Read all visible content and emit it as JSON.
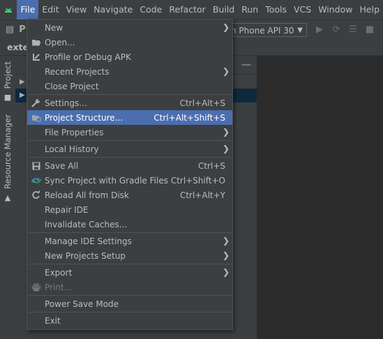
{
  "menubar": {
    "items": [
      "File",
      "Edit",
      "View",
      "Navigate",
      "Code",
      "Refactor",
      "Build",
      "Run",
      "Tools",
      "VCS",
      "Window",
      "Help"
    ],
    "active_index": 0
  },
  "toolbar": {
    "device": "n Phone API 30"
  },
  "tabstrip": {
    "crumb": "exte"
  },
  "leftstrip": {
    "project_label": "Project",
    "resource_manager_label": "Resource Manager"
  },
  "file_menu": {
    "items": [
      {
        "label": "New",
        "shortcut": "",
        "submenu": true,
        "icon": ""
      },
      {
        "label": "Open...",
        "shortcut": "",
        "submenu": false,
        "icon": "folder-open-icon"
      },
      {
        "label": "Profile or Debug APK",
        "shortcut": "",
        "submenu": false,
        "icon": "debug-apk-icon"
      },
      {
        "label": "Recent Projects",
        "shortcut": "",
        "submenu": true,
        "icon": ""
      },
      {
        "label": "Close Project",
        "shortcut": "",
        "submenu": false,
        "icon": ""
      },
      {
        "label": "Settings...",
        "shortcut": "Ctrl+Alt+S",
        "submenu": false,
        "icon": "wrench-icon"
      },
      {
        "label": "Project Structure...",
        "shortcut": "Ctrl+Alt+Shift+S",
        "submenu": false,
        "icon": "project-structure-icon",
        "selected": true
      },
      {
        "label": "File Properties",
        "shortcut": "",
        "submenu": true,
        "icon": ""
      },
      {
        "label": "Local History",
        "shortcut": "",
        "submenu": true,
        "icon": ""
      },
      {
        "label": "Save All",
        "shortcut": "Ctrl+S",
        "submenu": false,
        "icon": "save-icon"
      },
      {
        "label": "Sync Project with Gradle Files",
        "shortcut": "Ctrl+Shift+O",
        "submenu": false,
        "icon": "gradle-sync-icon"
      },
      {
        "label": "Reload All from Disk",
        "shortcut": "Ctrl+Alt+Y",
        "submenu": false,
        "icon": "reload-icon"
      },
      {
        "label": "Repair IDE",
        "shortcut": "",
        "submenu": false,
        "icon": ""
      },
      {
        "label": "Invalidate Caches...",
        "shortcut": "",
        "submenu": false,
        "icon": ""
      },
      {
        "label": "Manage IDE Settings",
        "shortcut": "",
        "submenu": true,
        "icon": ""
      },
      {
        "label": "New Projects Setup",
        "shortcut": "",
        "submenu": true,
        "icon": ""
      },
      {
        "label": "Export",
        "shortcut": "",
        "submenu": true,
        "icon": ""
      },
      {
        "label": "Print...",
        "shortcut": "",
        "submenu": false,
        "icon": "print-icon",
        "disabled": true
      },
      {
        "label": "Power Save Mode",
        "shortcut": "",
        "submenu": false,
        "icon": ""
      },
      {
        "label": "Exit",
        "shortcut": "",
        "submenu": false,
        "icon": ""
      }
    ]
  },
  "colors": {
    "menubar_bg": "#3c3f41",
    "selection": "#4b6eaf",
    "editor_bg": "#2b2b2b",
    "text": "#bbbbbb"
  }
}
